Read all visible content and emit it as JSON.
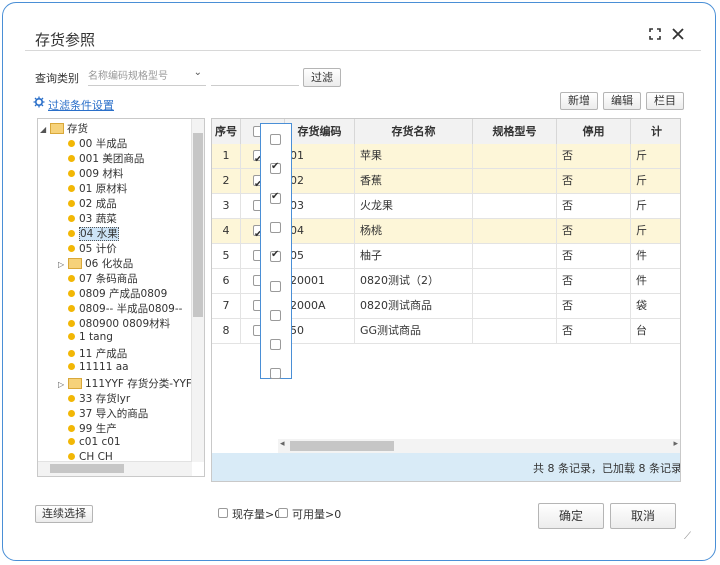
{
  "dialog": {
    "title": "存货参照"
  },
  "query": {
    "label": "查询类别",
    "select_value": "名称编码规格型号",
    "search_value": "",
    "filter_button": "过滤"
  },
  "filter_settings_link": "过滤条件设置",
  "toolbar": {
    "add": "新增",
    "edit": "编辑",
    "columns": "栏目"
  },
  "tree": {
    "root": "存货",
    "items": [
      {
        "label": "00 半成品",
        "type": "leaf"
      },
      {
        "label": "001 美团商品",
        "type": "leaf"
      },
      {
        "label": "009 材料",
        "type": "leaf"
      },
      {
        "label": "01 原材料",
        "type": "leaf"
      },
      {
        "label": "02 成品",
        "type": "leaf"
      },
      {
        "label": "03 蔬菜",
        "type": "leaf"
      },
      {
        "label": "04 水果",
        "type": "leaf",
        "selected": true
      },
      {
        "label": "05 计价",
        "type": "leaf"
      },
      {
        "label": "06 化妆品",
        "type": "folder"
      },
      {
        "label": "07 条码商品",
        "type": "leaf"
      },
      {
        "label": "0809 产成品0809",
        "type": "leaf"
      },
      {
        "label": "0809-- 半成品0809--",
        "type": "leaf"
      },
      {
        "label": "080900 0809材料",
        "type": "leaf"
      },
      {
        "label": "1 tang",
        "type": "leaf"
      },
      {
        "label": "11 产成品",
        "type": "leaf"
      },
      {
        "label": "11111 aa",
        "type": "leaf"
      },
      {
        "label": "111YYF 存货分类-YYF",
        "type": "folder"
      },
      {
        "label": "33 存货lyr",
        "type": "leaf"
      },
      {
        "label": "37 导入的商品",
        "type": "leaf"
      },
      {
        "label": "99 生产",
        "type": "leaf"
      },
      {
        "label": "c01 c01",
        "type": "leaf"
      },
      {
        "label": "CH CH",
        "type": "leaf"
      }
    ]
  },
  "grid": {
    "columns": [
      "序号",
      "",
      "存货编码",
      "存货名称",
      "规格型号",
      "停用",
      "计"
    ],
    "rows": [
      {
        "no": "1",
        "checked": true,
        "code": "01",
        "name": "苹果",
        "spec": "",
        "disabled": "否",
        "unit": "斤",
        "highlight": true
      },
      {
        "no": "2",
        "checked": true,
        "code": "02",
        "name": "香蕉",
        "spec": "",
        "disabled": "否",
        "unit": "斤",
        "highlight": true
      },
      {
        "no": "3",
        "checked": false,
        "code": "03",
        "name": "火龙果",
        "spec": "",
        "disabled": "否",
        "unit": "斤",
        "highlight": false
      },
      {
        "no": "4",
        "checked": true,
        "code": "04",
        "name": "杨桃",
        "spec": "",
        "disabled": "否",
        "unit": "斤",
        "highlight": true
      },
      {
        "no": "5",
        "checked": false,
        "code": "05",
        "name": "柚子",
        "spec": "",
        "disabled": "否",
        "unit": "件",
        "highlight": false
      },
      {
        "no": "6",
        "checked": false,
        "code": "20001",
        "name": "0820测试（2）",
        "spec": "",
        "disabled": "否",
        "unit": "件",
        "highlight": false
      },
      {
        "no": "7",
        "checked": false,
        "code": "2000A",
        "name": "0820测试商品",
        "spec": "",
        "disabled": "否",
        "unit": "袋",
        "highlight": false
      },
      {
        "no": "8",
        "checked": false,
        "code": "50",
        "name": "GG测试商品",
        "spec": "",
        "disabled": "否",
        "unit": "台",
        "highlight": false
      }
    ],
    "status": "共 8 条记录，已加载 8 条记录"
  },
  "column_popup": {
    "checks": [
      false,
      true,
      true,
      false,
      true,
      false,
      false,
      false,
      false
    ]
  },
  "footer": {
    "continuous_select": "连续选择",
    "stock_gt0": "现存量>0",
    "available_gt0": "可用量>0",
    "ok": "确定",
    "cancel": "取消"
  },
  "colors": {
    "accent": "#2a6fc9",
    "row_highlight": "#fdf6d8",
    "status_bar": "#d9ebf7"
  }
}
